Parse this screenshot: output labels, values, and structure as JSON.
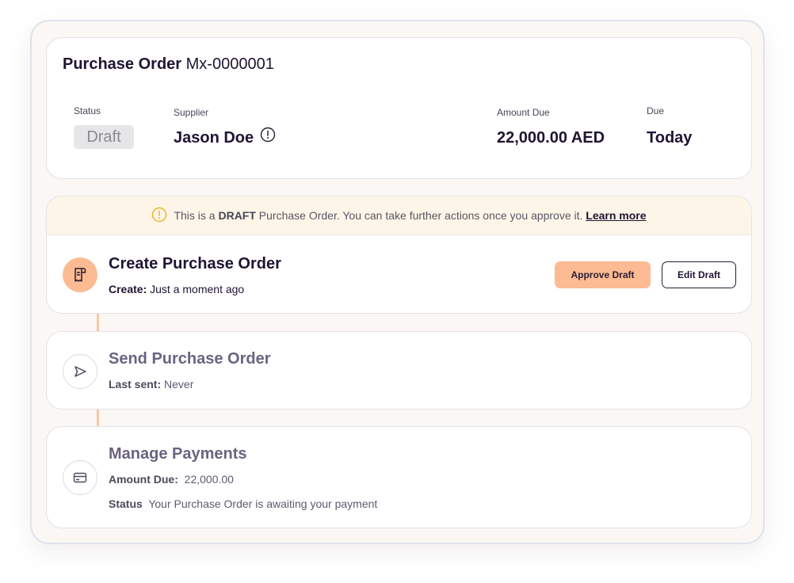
{
  "header": {
    "title_bold": "Purchase Order",
    "po_number": "Mx-0000001",
    "status_label": "Status",
    "status_value": "Draft",
    "supplier_label": "Supplier",
    "supplier_name": "Jason Doe",
    "amount_label": "Amount Due",
    "amount_value": "22,000.00 AED",
    "due_label": "Due",
    "due_value": "Today"
  },
  "banner": {
    "text_prefix": "This is a ",
    "text_bold": "DRAFT",
    "text_suffix": " Purchase Order. You can take further actions once you approve it. ",
    "link": "Learn more"
  },
  "steps": {
    "create": {
      "title": "Create Purchase Order",
      "sub_label": "Create:",
      "sub_value": " Just a moment ago",
      "approve_label": "Approve Draft",
      "edit_label": "Edit Draft",
      "icon": "receipt-icon"
    },
    "send": {
      "title": "Send Purchase Order",
      "sub_label": "Last sent:",
      "sub_value": " Never",
      "icon": "send-icon"
    },
    "payments": {
      "title": "Manage Payments",
      "amount_label": "Amount Due:",
      "amount_value": "  22,000.00",
      "status_label": "Status",
      "status_value": "  Your Purchase Order is awaiting your payment",
      "icon": "credit-card-icon"
    }
  },
  "colors": {
    "accent": "#fcbb92",
    "banner_bg": "#fdf6e8",
    "warning": "#f0b429",
    "text_dark": "#1f1433"
  }
}
